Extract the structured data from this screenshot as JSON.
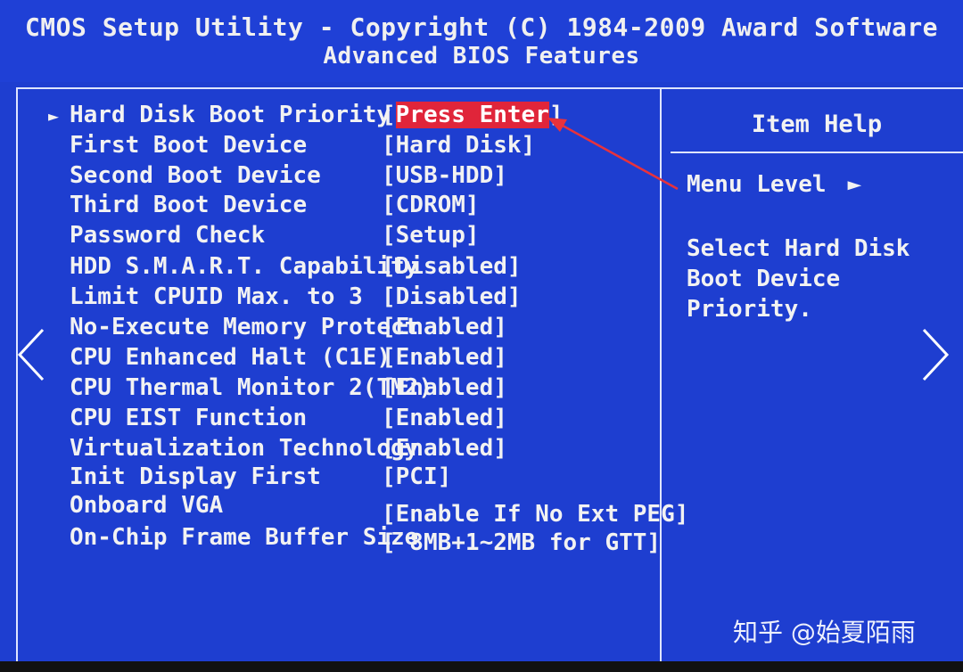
{
  "header": {
    "title": "CMOS Setup Utility - Copyright (C) 1984-2009 Award Software",
    "subtitle": "Advanced BIOS Features"
  },
  "settings": [
    {
      "label": "Hard Disk Boot Priority",
      "value_prefix": "[",
      "value": "Press Enter",
      "value_suffix": "]",
      "submenu": true,
      "selected": true
    },
    {
      "label": "First Boot Device",
      "value": "[Hard Disk]"
    },
    {
      "label": "Second Boot Device",
      "value": "[USB-HDD]"
    },
    {
      "label": "Third Boot Device",
      "value": "[CDROM]"
    },
    {
      "label": "Password Check",
      "value": "[Setup]"
    },
    {
      "label": "HDD S.M.A.R.T. Capability",
      "value": "[Disabled]"
    },
    {
      "label": "Limit CPUID Max. to 3",
      "value": "[Disabled]"
    },
    {
      "label": "No-Execute Memory Protect",
      "value": "[Enabled]"
    },
    {
      "label": "CPU Enhanced Halt (C1E)",
      "value": "[Enabled]"
    },
    {
      "label": "CPU Thermal Monitor 2(TM2)",
      "value": "[Enabled]"
    },
    {
      "label": "CPU EIST Function",
      "value": "[Enabled]"
    },
    {
      "label": "Virtualization Technology",
      "value": "[Enabled]"
    },
    {
      "label": "Init Display First",
      "value": "[PCI]"
    },
    {
      "label": "Onboard VGA",
      "value": "[Enable If No Ext PEG]"
    },
    {
      "label": "On-Chip Frame Buffer Size",
      "value": "[ 8MB+1~2MB for GTT]"
    }
  ],
  "item_help": {
    "title": "Item Help",
    "menu_level_label": "Menu Level",
    "menu_level_arrow": "►",
    "text": "Select Hard Disk Boot Device Priority."
  },
  "submenu_marker": "►",
  "watermark": "知乎 @始夏陌雨",
  "icons": {
    "prev": "chevron-left-icon",
    "next": "chevron-right-icon",
    "annotation": "red-arrow-icon"
  },
  "colors": {
    "bios_blue": "#1e3ed0",
    "highlight_red": "#e0253a",
    "text": "#f2f2f2"
  }
}
